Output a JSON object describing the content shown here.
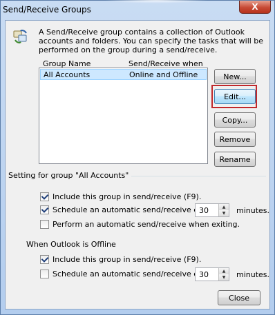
{
  "window": {
    "title": "Send/Receive Groups",
    "close_glyph": "X"
  },
  "description": "A Send/Receive group contains a collection of Outlook accounts and folders. You can specify the tasks that will be performed on the group during a send/receive.",
  "list": {
    "columns": [
      "Group Name",
      "Send/Receive when"
    ],
    "rows": [
      {
        "name": "All Accounts",
        "when": "Online and Offline"
      }
    ]
  },
  "buttons": {
    "new": "New...",
    "edit": "Edit...",
    "copy": "Copy...",
    "remove": "Remove",
    "rename": "Rename",
    "close": "Close"
  },
  "settings": {
    "group_label": "Setting for group \"All Accounts\"",
    "online": {
      "include_label": "Include this group in send/receive (F9).",
      "include_checked": true,
      "schedule_label": "Schedule an automatic send/receive every",
      "schedule_checked": true,
      "schedule_value": "30",
      "schedule_unit": "minutes.",
      "exit_label": "Perform an automatic send/receive when exiting.",
      "exit_checked": false
    },
    "offline_label": "When Outlook is Offline",
    "offline": {
      "include_label": "Include this group in send/receive (F9).",
      "include_checked": true,
      "schedule_label": "Schedule an automatic send/receive every",
      "schedule_checked": false,
      "schedule_value": "30",
      "schedule_unit": "minutes."
    }
  },
  "colors": {
    "highlight_box": "#c0282b",
    "selected_row": "#cde8ff"
  }
}
